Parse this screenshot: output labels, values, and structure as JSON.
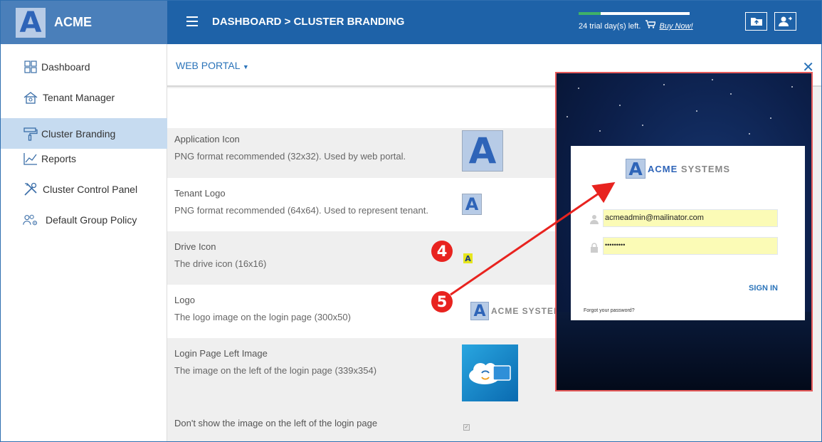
{
  "brand": {
    "name": "ACME",
    "logo_letter": "A"
  },
  "header": {
    "breadcrumb": "DASHBOARD > CLUSTER BRANDING",
    "trial_progress": 0.2,
    "trial_text": "24 trial day(s) left.",
    "buy_now": "Buy Now!"
  },
  "sidebar": {
    "items": [
      {
        "label": "Dashboard",
        "icon": "dashboard-grid-icon"
      },
      {
        "label": "Tenant Manager",
        "icon": "tenant-house-icon"
      },
      {
        "label": "Cluster Branding",
        "icon": "paint-roller-icon",
        "active": true
      },
      {
        "label": "Reports",
        "icon": "line-chart-icon"
      },
      {
        "label": "Cluster Control Panel",
        "icon": "tools-icon"
      },
      {
        "label": "Default Group Policy",
        "icon": "users-gear-icon"
      }
    ]
  },
  "panel": {
    "dropdown_label": "WEB PORTAL",
    "rows": [
      {
        "title": "Application Icon",
        "desc": "PNG format recommended (32x32). Used by web portal."
      },
      {
        "title": "Tenant Logo",
        "desc": "PNG format recommended (64x64). Used to represent tenant."
      },
      {
        "title": "Drive Icon",
        "desc": "The drive icon (16x16)"
      },
      {
        "title": "Logo",
        "desc": "The logo image on the login page (300x50)"
      },
      {
        "title": "Login Page Left Image",
        "desc": "The image on the left of the login page (339x354)"
      },
      {
        "title": "Don't show the image on the left of the login page"
      }
    ],
    "logo_preview_text": "ACME SYSTEMS"
  },
  "login_preview": {
    "logo_word_1": "ACME",
    "logo_word_2": "SYSTEMS",
    "email": "acmeadmin@mailinator.com",
    "password_mask": "•••••••••",
    "sign_in": "SIGN IN",
    "forgot": "Forgot your password?"
  },
  "callouts": {
    "first": "4",
    "second": "5"
  },
  "colors": {
    "header": "#1e62a8",
    "brand": "#4a7fba",
    "active_nav": "#c6dbf0",
    "callout": "#e8231f",
    "accent": "#2a73b9"
  }
}
